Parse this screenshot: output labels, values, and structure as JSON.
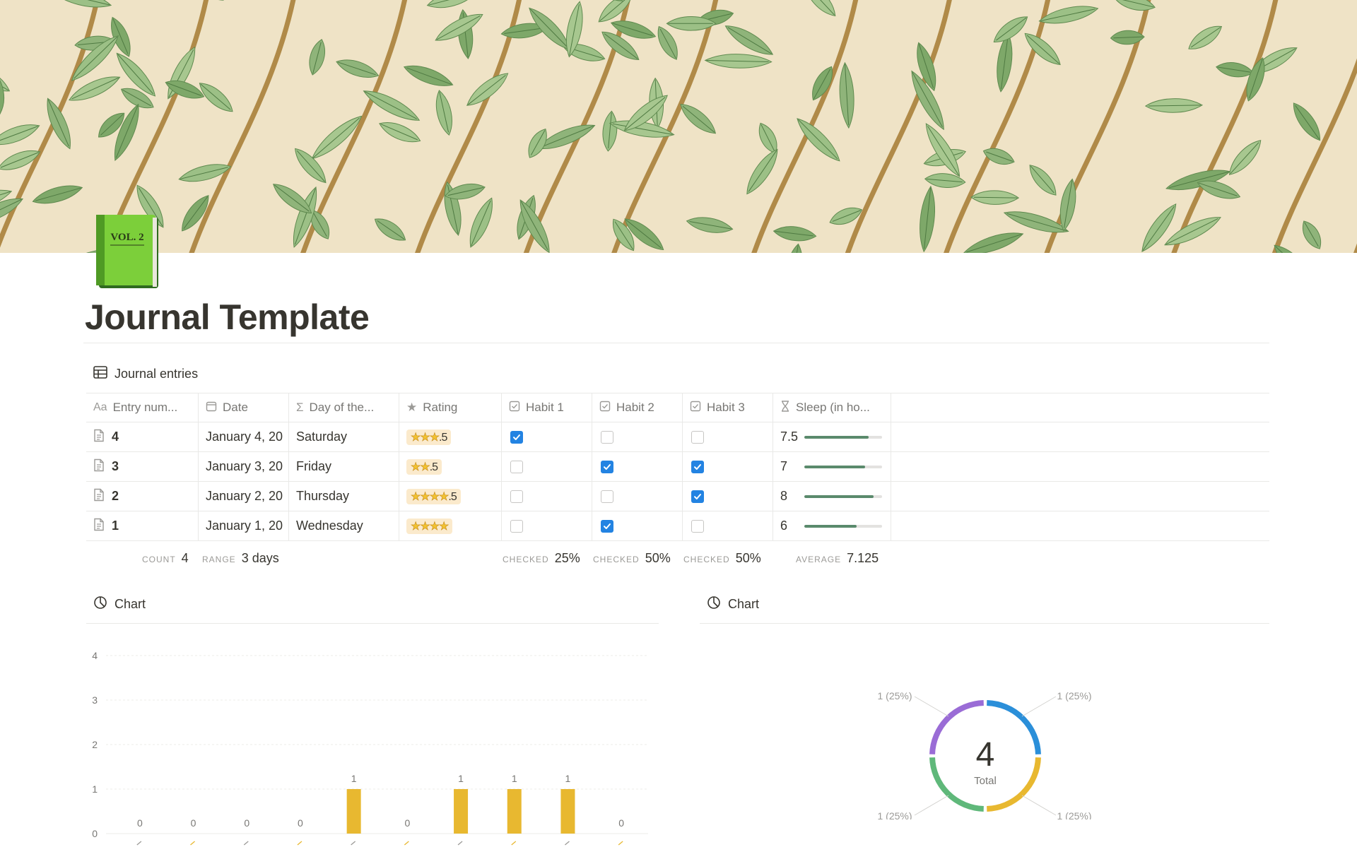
{
  "page": {
    "title": "Journal Template",
    "icon_label": "VOL. 2"
  },
  "database": {
    "title": "Journal entries",
    "columns": [
      {
        "label": "Entry num...",
        "icon": "text-icon"
      },
      {
        "label": "Date",
        "icon": "calendar-icon"
      },
      {
        "label": "Day of the...",
        "icon": "sigma-icon"
      },
      {
        "label": "Rating",
        "icon": "star-icon"
      },
      {
        "label": "Habit 1",
        "icon": "checkbox-icon"
      },
      {
        "label": "Habit 2",
        "icon": "checkbox-icon"
      },
      {
        "label": "Habit 3",
        "icon": "checkbox-icon"
      },
      {
        "label": "Sleep (in ho...",
        "icon": "hourglass-icon"
      }
    ],
    "rows": [
      {
        "entry": "4",
        "date": "January 4, 20",
        "day": "Saturday",
        "stars": 3,
        "half": ".5",
        "habit1": true,
        "habit2": false,
        "habit3": false,
        "sleep": "7.5",
        "sleep_fraction": 0.83
      },
      {
        "entry": "3",
        "date": "January 3, 20",
        "day": "Friday",
        "stars": 2,
        "half": ".5",
        "habit1": false,
        "habit2": true,
        "habit3": true,
        "sleep": "7",
        "sleep_fraction": 0.78
      },
      {
        "entry": "2",
        "date": "January 2, 20",
        "day": "Thursday",
        "stars": 4,
        "half": ".5",
        "habit1": false,
        "habit2": false,
        "habit3": true,
        "sleep": "8",
        "sleep_fraction": 0.89
      },
      {
        "entry": "1",
        "date": "January 1, 20",
        "day": "Wednesday",
        "stars": 4,
        "half": "",
        "habit1": false,
        "habit2": true,
        "habit3": false,
        "sleep": "6",
        "sleep_fraction": 0.67
      }
    ],
    "summary": {
      "count_label": "COUNT",
      "count_value": "4",
      "range_label": "RANGE",
      "range_value": "3 days",
      "h1_label": "CHECKED",
      "h1_value": "25%",
      "h2_label": "CHECKED",
      "h2_value": "50%",
      "h3_label": "CHECKED",
      "h3_value": "50%",
      "avg_label": "AVERAGE",
      "avg_value": "7.125"
    }
  },
  "charts": {
    "left_title": "Chart",
    "right_title": "Chart"
  },
  "colors": {
    "bar": "#e8b830",
    "checkbox": "#2383e2",
    "sleep_bar": "#5a8a6c",
    "donut": [
      "#2b8fd9",
      "#e8b830",
      "#5fb87a",
      "#9a6cd6"
    ]
  },
  "chart_data": [
    {
      "type": "bar",
      "title": "",
      "xlabel": "",
      "ylabel": "",
      "ylim": [
        0,
        4
      ],
      "yticks": [
        "0",
        "1",
        "2",
        "3",
        "4"
      ],
      "values": [
        0,
        0,
        0,
        0,
        1,
        0,
        1,
        1,
        1,
        0
      ],
      "data_labels": [
        "0",
        "0",
        "0",
        "0",
        "1",
        "0",
        "1",
        "1",
        "1",
        "0"
      ]
    },
    {
      "type": "pie",
      "title": "",
      "center_value": "4",
      "center_label": "Total",
      "values": [
        1,
        1,
        1,
        1
      ],
      "labels": [
        "1 (25%)",
        "1 (25%)",
        "1 (25%)",
        "1 (25%)"
      ]
    }
  ]
}
